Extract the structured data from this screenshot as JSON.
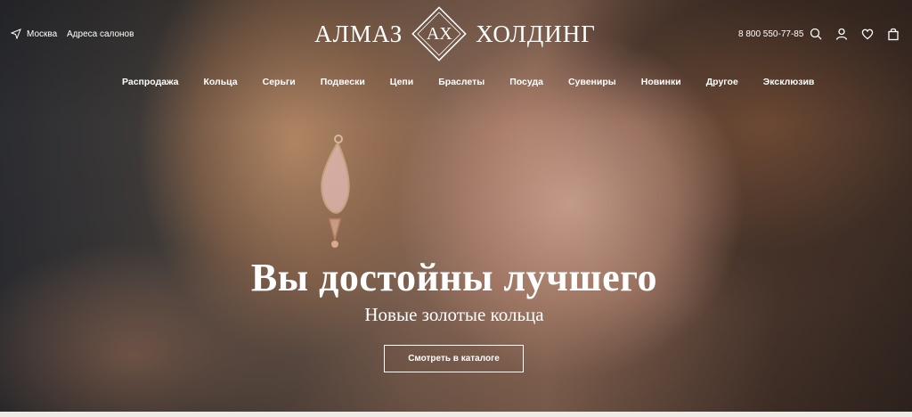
{
  "header": {
    "city": "Москва",
    "salons_link": "Адреса салонов",
    "logo_left": "АЛМАЗ",
    "logo_mark": "АХ",
    "logo_right": "ХОЛДИНГ",
    "phone": "8 800 550-77-85",
    "icons": [
      "location-arrow-icon",
      "search-icon",
      "user-icon",
      "heart-icon",
      "bag-icon"
    ]
  },
  "nav": {
    "items": [
      {
        "label": "Распродажа"
      },
      {
        "label": "Кольца"
      },
      {
        "label": "Серьги"
      },
      {
        "label": "Подвески"
      },
      {
        "label": "Цепи"
      },
      {
        "label": "Браслеты"
      },
      {
        "label": "Посуда"
      },
      {
        "label": "Сувениры"
      },
      {
        "label": "Новинки"
      },
      {
        "label": "Другое"
      },
      {
        "label": "Эксклюзив"
      }
    ]
  },
  "hero": {
    "headline": "Вы достойны лучшего",
    "subline": "Новые золотые кольца",
    "cta_label": "Смотреть в каталоге"
  }
}
